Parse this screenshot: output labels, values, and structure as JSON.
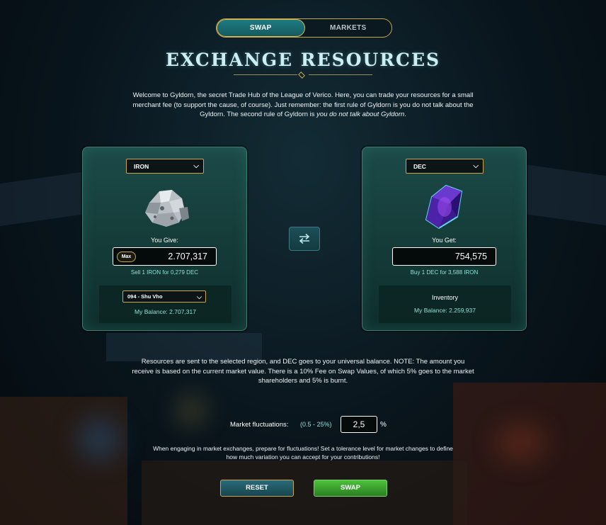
{
  "tabs": {
    "swap_label": "SWAP",
    "markets_label": "MARKETS",
    "active": "SWAP"
  },
  "title": "EXCHANGE RESOURCES",
  "intro": {
    "text": "Welcome to Gyldorn, the secret Trade Hub of the League of Verico. Here, you can trade your resources for a small merchant fee (to support the cause, of course). Just remember: the first rule of Gyldorn is you do not talk about the Gyldorn. The second rule of Gyldorn is ",
    "emphasis": "you do not talk about Gyldorn",
    "end": "."
  },
  "give": {
    "resource": "IRON",
    "label": "You Give:",
    "max_label": "Max",
    "amount": "2.707,317",
    "rate": "Sell 1 IRON for 0,279 DEC",
    "region": "094 - Shu Vho",
    "balance": "My Balance: 2.707,317"
  },
  "get": {
    "resource": "DEC",
    "label": "You Get:",
    "amount": "754,575",
    "rate": "Buy 1 DEC for 3,588 IRON",
    "inventory_label": "Inventory",
    "balance": "My Balance: 2.259,937"
  },
  "notice": "Resources are sent to the selected region, and DEC goes to your universal balance. NOTE: The amount you receive is based on the current market value. There is a 10% Fee on Swap Values, of which 5% goes to the market shareholders and 5% is burnt.",
  "fluctuation": {
    "label": "Market fluctuations:",
    "range": "(0.5 - 25%)",
    "value": "2,5",
    "unit": "%",
    "note": "When engaging in market exchanges, prepare for fluctuations! Set a tolerance level for market changes to define how much variation you can accept for your contributions!"
  },
  "buttons": {
    "reset": "RESET",
    "swap": "SWAP"
  },
  "colors": {
    "accent_gold": "#c9a64a",
    "accent_teal": "#8fe0d8",
    "swap_green": "#3fa52e"
  }
}
